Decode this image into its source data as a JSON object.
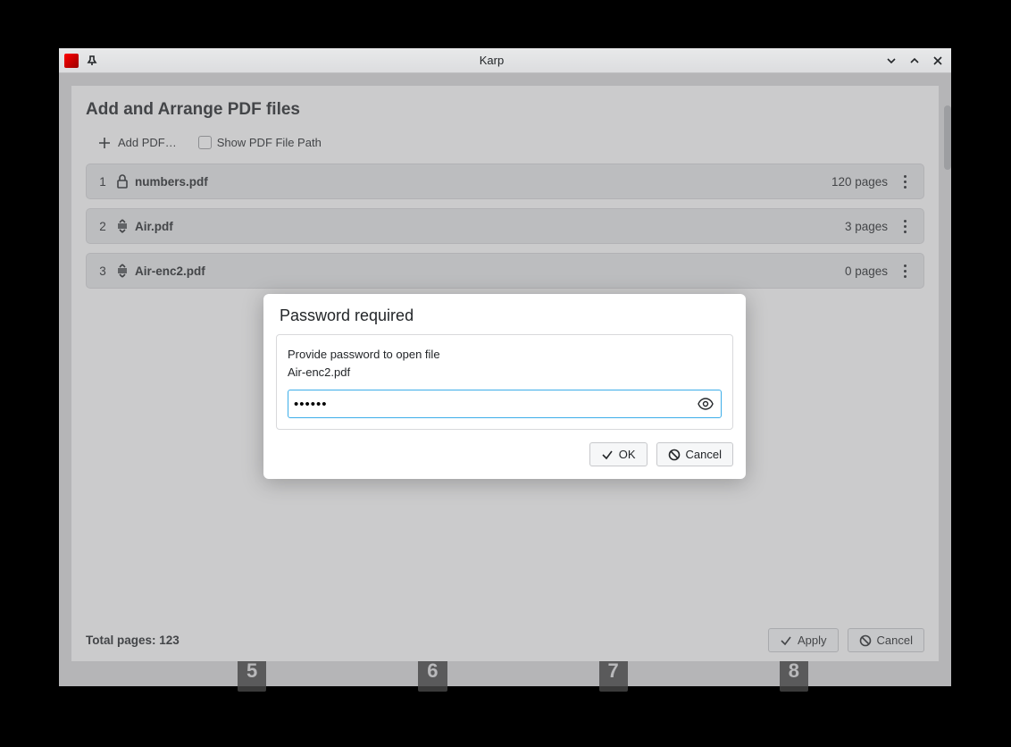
{
  "window": {
    "title": "Karp"
  },
  "arrange": {
    "title": "Add and Arrange PDF files",
    "add_label": "Add PDF…",
    "show_path_label": "Show PDF File Path",
    "total_label": "Total pages: 123",
    "apply_label": "Apply",
    "cancel_label": "Cancel",
    "files": [
      {
        "index": "1",
        "name": "numbers.pdf",
        "pages": "120 pages",
        "icon": "lock"
      },
      {
        "index": "2",
        "name": "Air.pdf",
        "pages": "3 pages",
        "icon": "drag"
      },
      {
        "index": "3",
        "name": "Air-enc2.pdf",
        "pages": "0 pages",
        "icon": "drag"
      }
    ]
  },
  "password_dialog": {
    "title": "Password required",
    "prompt_line1": "Provide password to open file",
    "prompt_line2": "Air-enc2.pdf",
    "value": "••••••",
    "ok_label": "OK",
    "cancel_label": "Cancel"
  },
  "thumbs": [
    "5",
    "6",
    "7",
    "8"
  ]
}
